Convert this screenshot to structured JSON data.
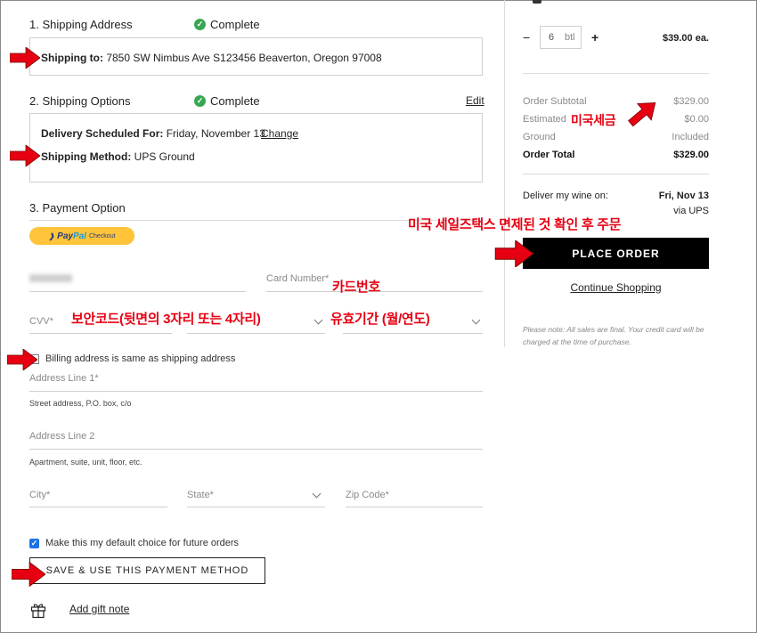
{
  "shipping_address": {
    "title": "1. Shipping Address",
    "status": "Complete",
    "to_label": "Shipping to:",
    "to_value": "7850 SW Nimbus Ave S123456 Beaverton, Oregon 97008"
  },
  "shipping_options": {
    "title": "2. Shipping Options",
    "status": "Complete",
    "edit": "Edit",
    "delivery_label": "Delivery Scheduled For:",
    "delivery_value": "Friday, November 13",
    "change": "Change",
    "method_label": "Shipping Method:",
    "method_value": "UPS Ground"
  },
  "payment": {
    "title": "3. Payment Option",
    "paypal_pay": "Pay",
    "paypal_pal": "Pal",
    "paypal_checkout": "Checkout",
    "card_number_label": "Card Number*",
    "cvv_label": "CVV*",
    "billing_same": "Billing address is same as shipping address",
    "address1_label": "Address Line 1*",
    "address1_hint": "Street address, P.O. box, c/o",
    "address2_label": "Address Line 2",
    "address2_hint": "Apartment, suite, unit, floor, etc.",
    "city_label": "City*",
    "state_label": "State*",
    "zip_label": "Zip Code*",
    "default_choice": "Make this my default choice for future orders",
    "save_button": "SAVE & USE THIS PAYMENT METHOD",
    "gift_note": "Add gift note"
  },
  "cart": {
    "minus": "−",
    "qty": "6",
    "unit": "btl",
    "plus": "+",
    "price": "$39.00 ea."
  },
  "summary": {
    "subtotal_label": "Order Subtotal",
    "subtotal_value": "$329.00",
    "tax_label": "Estimated",
    "tax_value": "$0.00",
    "ground_label": "Ground",
    "ground_value": "Included",
    "total_label": "Order Total",
    "total_value": "$329.00",
    "deliver_label": "Deliver my wine on:",
    "deliver_date": "Fri, Nov 13",
    "deliver_via": "via UPS",
    "place_order": "PLACE ORDER",
    "continue": "Continue Shopping",
    "note": "Please note: All sales are final. Your credit card will be charged at the time of purchase."
  },
  "annotations": {
    "tax": "미국세금",
    "place_order": "미국 세일즈택스 면제된 것 확인 후 주문",
    "card_number": "카드번호",
    "cvv": "보안코드(뒷면의 3자리 또는 4자리)",
    "expiry": "유효기간 (월/연도)"
  },
  "colors": {
    "accent_red": "#e60012",
    "check_green": "#3aa655",
    "paypal_yellow": "#ffc439",
    "paypal_blue_dark": "#253b80",
    "paypal_blue_light": "#179bd7",
    "checkbox_blue": "#1a73e8"
  },
  "icons": [
    "check-icon",
    "arrow-right-icon",
    "chevron-down-icon",
    "gift-icon",
    "checkbox-icon"
  ]
}
